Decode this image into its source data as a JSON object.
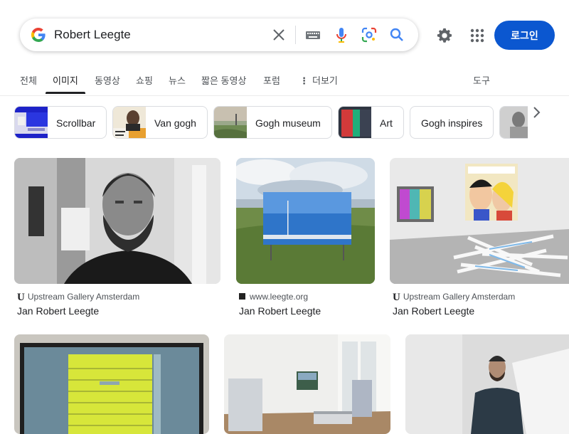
{
  "search": {
    "query": "Robert Leegte"
  },
  "header": {
    "login_label": "로그인"
  },
  "tabs": [
    {
      "label": "전체"
    },
    {
      "label": "이미지"
    },
    {
      "label": "동영상"
    },
    {
      "label": "쇼핑"
    },
    {
      "label": "뉴스"
    },
    {
      "label": "짧은 동영상"
    },
    {
      "label": "포럼"
    },
    {
      "label": "더보기"
    },
    {
      "label": "도구"
    }
  ],
  "active_tab": "이미지",
  "chips": [
    {
      "label": "Scrollbar"
    },
    {
      "label": "Van gogh"
    },
    {
      "label": "Gogh museum"
    },
    {
      "label": "Art"
    },
    {
      "label": "Gogh inspires"
    }
  ],
  "results": [
    {
      "source": "Upstream Gallery Amsterdam",
      "title": "Jan Robert Leegte"
    },
    {
      "source": "www.leegte.org",
      "title": "Jan Robert Leegte"
    },
    {
      "source": "Upstream Gallery Amsterdam",
      "title": "Jan Robert Leegte"
    }
  ],
  "colors": {
    "accent": "#0b57d0",
    "text": "#202124",
    "secondary": "#4d5156"
  }
}
